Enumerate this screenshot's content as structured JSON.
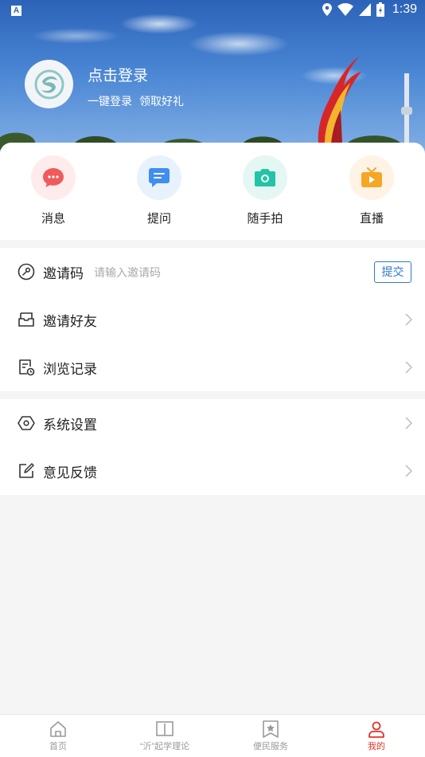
{
  "status_bar": {
    "time": "1:39"
  },
  "profile": {
    "title": "点击登录",
    "subtitle_1": "一键登录",
    "subtitle_2": "领取好礼"
  },
  "quick_actions": [
    {
      "label": "消息",
      "icon": "message-icon",
      "color": "#ef5b5b",
      "bg": "#fdeceb"
    },
    {
      "label": "提问",
      "icon": "question-icon",
      "color": "#3f8ef0",
      "bg": "#e8f2fd"
    },
    {
      "label": "随手拍",
      "icon": "camera-icon",
      "color": "#22c3a6",
      "bg": "#e4f7f3"
    },
    {
      "label": "直播",
      "icon": "live-tv-icon",
      "color": "#f5a623",
      "bg": "#fef3e4"
    }
  ],
  "invite": {
    "label": "邀请码",
    "placeholder": "请输入邀请码",
    "submit_label": "提交"
  },
  "menu_group_1": [
    {
      "label": "邀请好友",
      "icon": "inbox-icon"
    },
    {
      "label": "浏览记录",
      "icon": "history-icon"
    }
  ],
  "menu_group_2": [
    {
      "label": "系统设置",
      "icon": "settings-hexagon-icon"
    },
    {
      "label": "意见反馈",
      "icon": "feedback-edit-icon"
    }
  ],
  "bottom_nav": [
    {
      "label": "首页",
      "icon": "home-icon",
      "active": false
    },
    {
      "label": "“沂”起学理论",
      "icon": "book-icon",
      "active": false
    },
    {
      "label": "便民服务",
      "icon": "bookmark-star-icon",
      "active": false
    },
    {
      "label": "我的",
      "icon": "user-icon",
      "active": true
    }
  ],
  "colors": {
    "accent_blue": "#2a7bd6",
    "active_red": "#e0352b"
  }
}
